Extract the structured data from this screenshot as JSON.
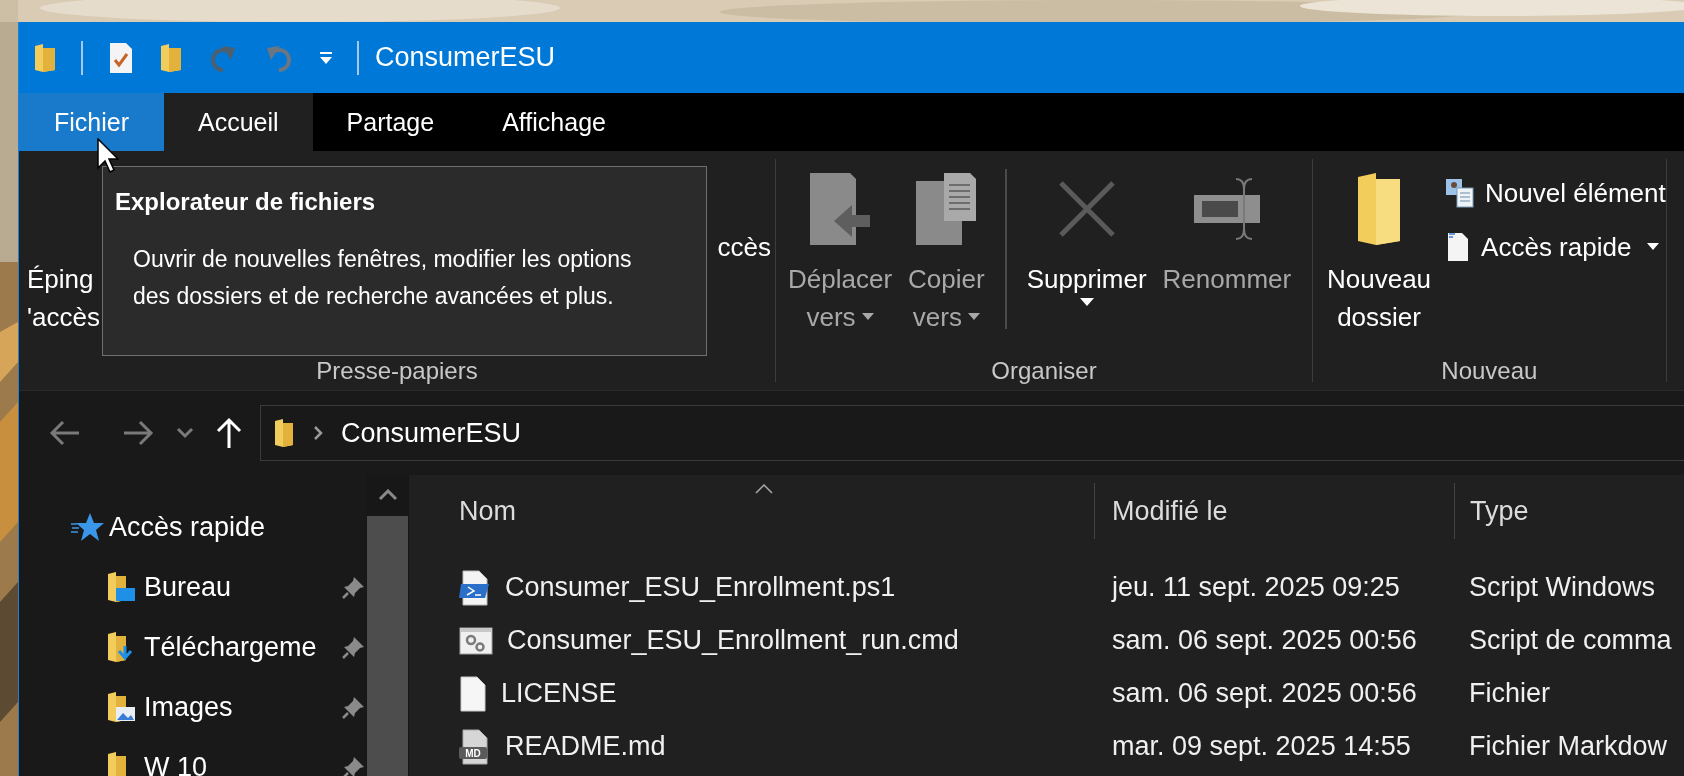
{
  "window": {
    "title": "ConsumerESU",
    "quick_access": [
      {
        "kind": "folder"
      },
      {
        "kind": "properties"
      },
      {
        "kind": "new_folder"
      },
      {
        "kind": "redo"
      },
      {
        "kind": "undo"
      },
      {
        "kind": "customize"
      }
    ]
  },
  "tabs": [
    {
      "label": "Fichier",
      "kind": "file",
      "selected": false
    },
    {
      "label": "Accueil",
      "kind": "tab",
      "selected": true
    },
    {
      "label": "Partage",
      "kind": "tab",
      "selected": false
    },
    {
      "label": "Affichage",
      "kind": "tab",
      "selected": false
    }
  ],
  "ribbon": {
    "groups": [
      {
        "kind": "clipboard",
        "label": "Presse-papiers",
        "pin_label": [
          "Éping",
          "'accès"
        ],
        "partial_label": "ccès"
      },
      {
        "kind": "buttons",
        "label": "Organiser",
        "buttons": [
          {
            "kind": "move",
            "lines": [
              "Déplacer",
              "vers"
            ],
            "dropdown": true,
            "disabled": true,
            "separator_before": false
          },
          {
            "kind": "copy",
            "lines": [
              "Copier",
              "vers"
            ],
            "dropdown": true,
            "disabled": true,
            "separator_before": false
          },
          {
            "kind": "delete",
            "lines": [
              "Supprimer"
            ],
            "dropdown": true,
            "disabled": false,
            "separator_before": true
          },
          {
            "kind": "rename",
            "lines": [
              "Renommer"
            ],
            "dropdown": false,
            "disabled": true,
            "separator_before": false
          }
        ]
      },
      {
        "kind": "new",
        "label": "Nouveau",
        "buttons": [
          {
            "kind": "new_folder",
            "lines": [
              "Nouveau",
              "dossier"
            ],
            "dropdown": false,
            "disabled": false,
            "separator_before": false
          }
        ],
        "small_buttons": [
          {
            "kind": "new_item",
            "label": "Nouvel élément",
            "dropdown": false
          },
          {
            "kind": "quick_access",
            "label": "Accès rapide",
            "dropdown": true
          }
        ]
      }
    ]
  },
  "tooltip": {
    "title": "Explorateur de fichiers",
    "text": "Ouvrir de nouvelles fenêtres, modifier les options des dossiers et de recherche avancées et plus."
  },
  "nav_buttons": [
    {
      "kind": "back",
      "disabled": true
    },
    {
      "kind": "forward",
      "disabled": true
    },
    {
      "kind": "recent",
      "disabled": true
    },
    {
      "kind": "up",
      "disabled": false
    }
  ],
  "address_bar": {
    "path": [
      "ConsumerESU"
    ]
  },
  "nav_pane": {
    "items": [
      {
        "label": "Accès rapide",
        "kind": "star",
        "children": [
          {
            "label": "Bureau",
            "kind": "desktop",
            "pinned": true
          },
          {
            "label": "Téléchargeme",
            "kind": "downloads",
            "pinned": true
          },
          {
            "label": "Images",
            "kind": "pictures",
            "pinned": true
          },
          {
            "label": "W 10",
            "kind": "folder",
            "pinned": true
          }
        ]
      }
    ]
  },
  "file_list": {
    "columns": [
      {
        "label": "Nom",
        "sorted": true
      },
      {
        "label": "Modifié le",
        "sorted": false
      },
      {
        "label": "Type",
        "sorted": false
      }
    ],
    "rows": [
      {
        "kind": "ps1",
        "name": "Consumer_ESU_Enrollment.ps1",
        "modified": "jeu. 11 sept. 2025 09:25",
        "type": "Script Windows"
      },
      {
        "kind": "cmd",
        "name": "Consumer_ESU_Enrollment_run.cmd",
        "modified": "sam. 06 sept. 2025 00:56",
        "type": "Script de comma"
      },
      {
        "kind": "file",
        "name": "LICENSE",
        "modified": "sam. 06 sept. 2025 00:56",
        "type": "Fichier"
      },
      {
        "kind": "md",
        "badge": "MD",
        "name": "README.md",
        "modified": "mar. 09 sept. 2025 14:55",
        "type": "Fichier Markdow"
      }
    ]
  }
}
